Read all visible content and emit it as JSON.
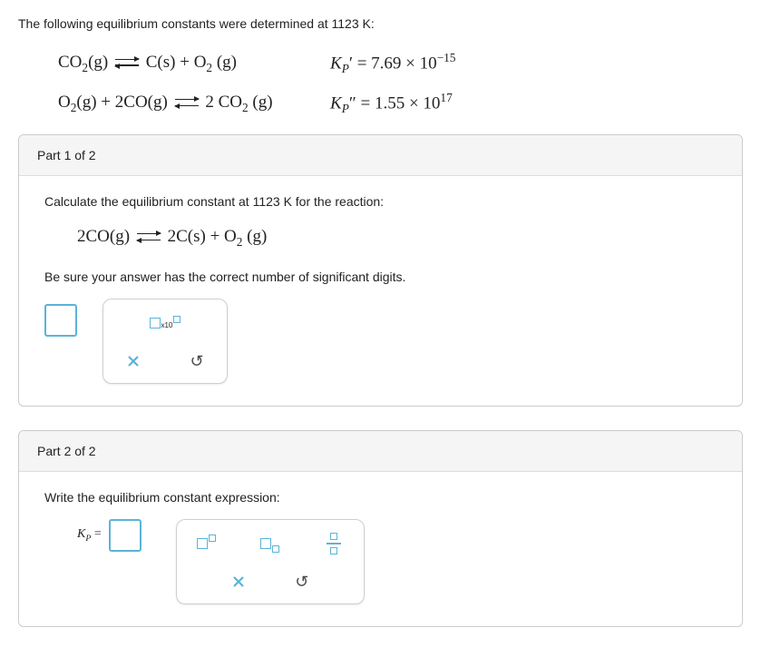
{
  "intro": "The following equilibrium constants were determined at 1123 K:",
  "eq1": {
    "lhs": "CO",
    "lhs_sub": "2",
    "phase1": "(g)",
    "rhs_a": "C",
    "rhs_a_phase": "(s)",
    "plus": " + ",
    "rhs_b": "O",
    "rhs_b_sub": "2",
    "rhs_b_phase": "(g)"
  },
  "kp1_label": "K",
  "kp1_sub": "P",
  "kp1_prime": "′",
  "kp1_val": " = 7.69 × 10",
  "kp1_exp": "−15",
  "eq2": {
    "a": "O",
    "a_sub": "2",
    "a_phase": "(g)",
    "plus": " + ",
    "b_coeff": "2",
    "b": "CO",
    "b_phase": "(g)",
    "c_coeff": "2",
    "c": "CO",
    "c_sub": "2",
    "c_phase": "(g)"
  },
  "kp2_label": "K",
  "kp2_sub": "P",
  "kp2_prime": "″",
  "kp2_val": " = 1.55 × 10",
  "kp2_exp": "17",
  "part1": {
    "head": "Part 1 of 2",
    "prompt": "Calculate the equilibrium constant at 1123 K for the reaction:",
    "eq": {
      "a_coeff": "2",
      "a": "CO",
      "a_phase": "(g)",
      "b_coeff": "2",
      "b": "C",
      "b_phase": "(s)",
      "plus": " + ",
      "c": "O",
      "c_sub": "2",
      "c_phase": "(g)"
    },
    "note": "Be sure your answer has the correct number of significant digits.",
    "x10": "x10"
  },
  "part2": {
    "head": "Part 2 of 2",
    "prompt": "Write the equilibrium constant expression:",
    "kp": "K",
    "kp_sub": "P",
    "eq": " = "
  }
}
